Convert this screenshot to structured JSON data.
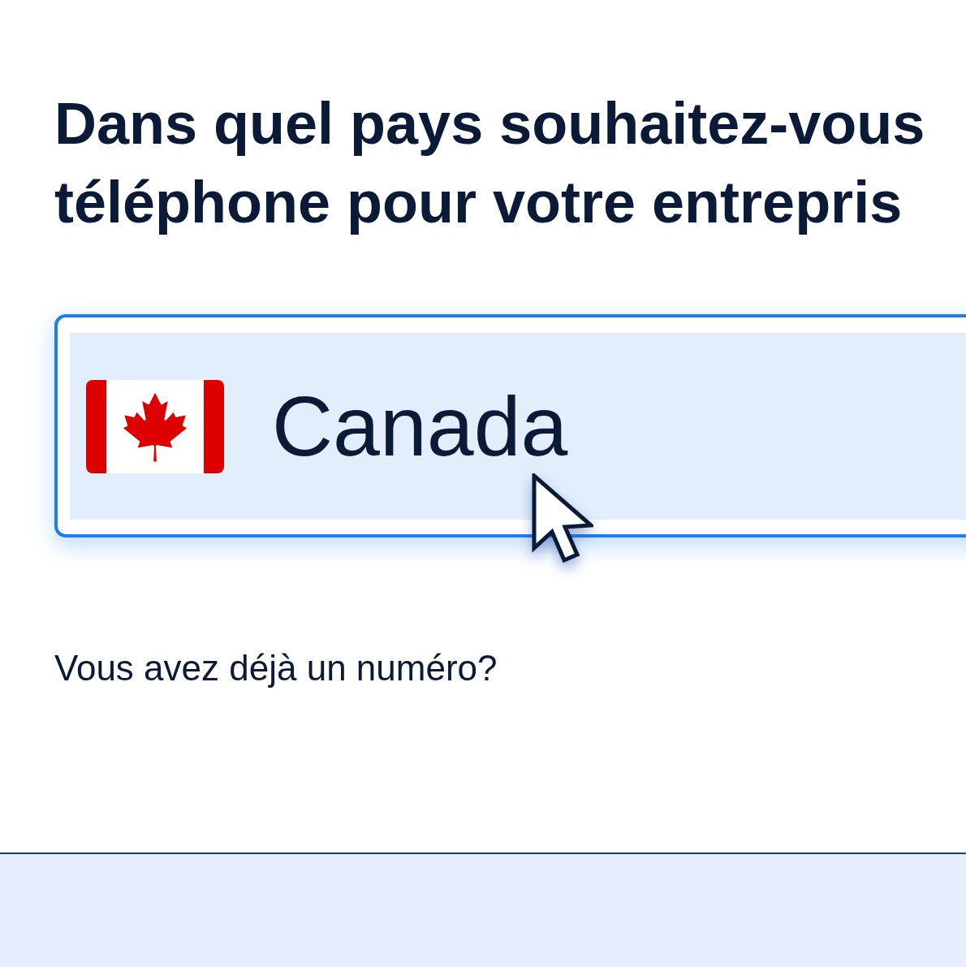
{
  "heading": {
    "lines": [
      "Dans quel pays souhaitez-vous",
      "téléphone pour votre entrepris"
    ]
  },
  "country_select": {
    "value": "Canada",
    "focused": true
  },
  "prompt": "Vous avez déjà un numéro?"
}
